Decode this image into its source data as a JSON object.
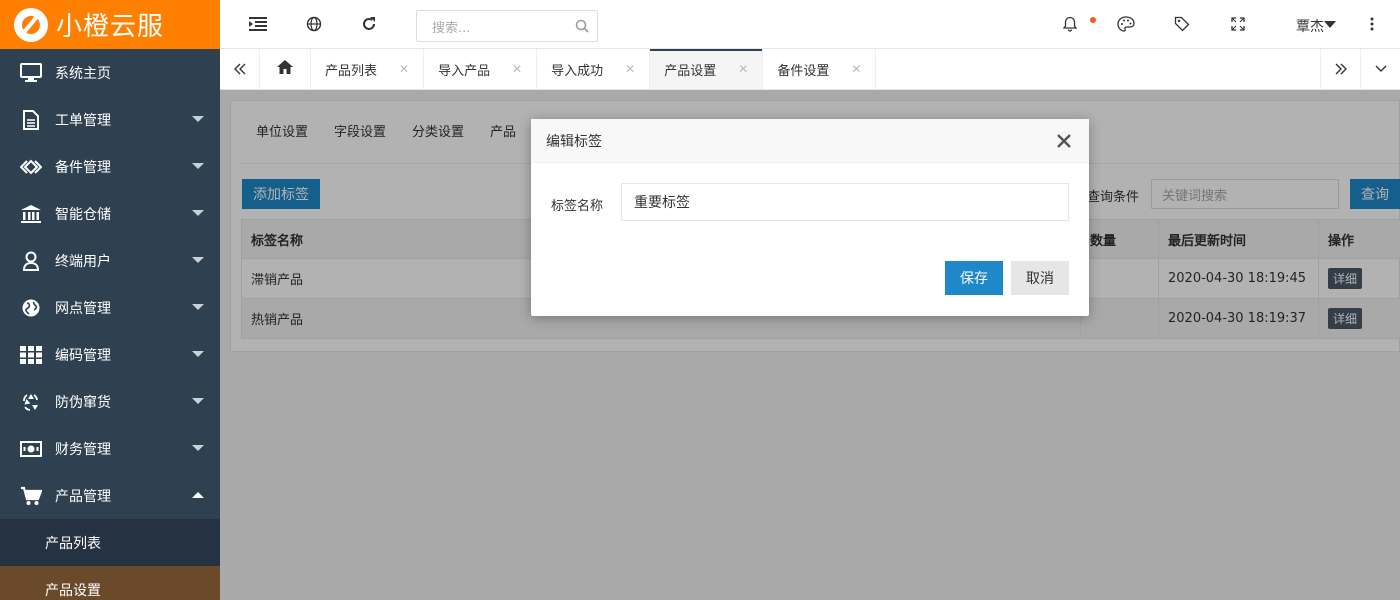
{
  "app": {
    "logo_text": "小橙云服"
  },
  "sidebar": {
    "items": [
      {
        "label": "系统主页",
        "icon": "monitor-icon",
        "has_caret": false
      },
      {
        "label": "工单管理",
        "icon": "document-icon",
        "has_caret": true
      },
      {
        "label": "备件管理",
        "icon": "diamond-link-icon",
        "has_caret": true
      },
      {
        "label": "智能仓储",
        "icon": "bank-icon",
        "has_caret": true
      },
      {
        "label": "终端用户",
        "icon": "user-icon",
        "has_caret": true
      },
      {
        "label": "网点管理",
        "icon": "globe-icon",
        "has_caret": true
      },
      {
        "label": "编码管理",
        "icon": "grid-icon",
        "has_caret": true
      },
      {
        "label": "防伪窜货",
        "icon": "recycle-icon",
        "has_caret": true
      },
      {
        "label": "财务管理",
        "icon": "money-icon",
        "has_caret": true
      },
      {
        "label": "产品管理",
        "icon": "cart-icon",
        "has_caret": true,
        "expanded": true
      }
    ],
    "subitems": [
      {
        "label": "产品列表"
      },
      {
        "label": "产品设置",
        "active": true
      }
    ]
  },
  "topbar": {
    "search_placeholder": "搜索...",
    "user_name": "覃杰"
  },
  "tabs": [
    {
      "label": "产品列表"
    },
    {
      "label": "导入产品"
    },
    {
      "label": "导入成功"
    },
    {
      "label": "产品设置",
      "active": true
    },
    {
      "label": "备件设置"
    }
  ],
  "content": {
    "subtabs": [
      "单位设置",
      "字段设置",
      "分类设置",
      "产品"
    ],
    "add_button": "添加标签",
    "query_label": "查询条件",
    "keyword_placeholder": "关键词搜索",
    "query_button": "查询",
    "table": {
      "columns": [
        "标签名称",
        "数量",
        "最后更新时间",
        "操作"
      ],
      "rows": [
        {
          "name": "滞销产品",
          "count": "",
          "updated": "2020-04-30 18:19:45",
          "action": "详细"
        },
        {
          "name": "热销产品",
          "count": "",
          "updated": "2020-04-30 18:19:37",
          "action": "详细"
        }
      ]
    }
  },
  "modal": {
    "title": "编辑标签",
    "field_label": "标签名称",
    "field_value": "重要标签",
    "save_button": "保存",
    "cancel_button": "取消"
  },
  "colors": {
    "brand_orange": "#ff7f00",
    "sidebar_bg": "#2f4050",
    "primary_blue": "#1e88c9",
    "notification_dot": "#ff5722",
    "active_submenu": "#6b4a2b"
  }
}
